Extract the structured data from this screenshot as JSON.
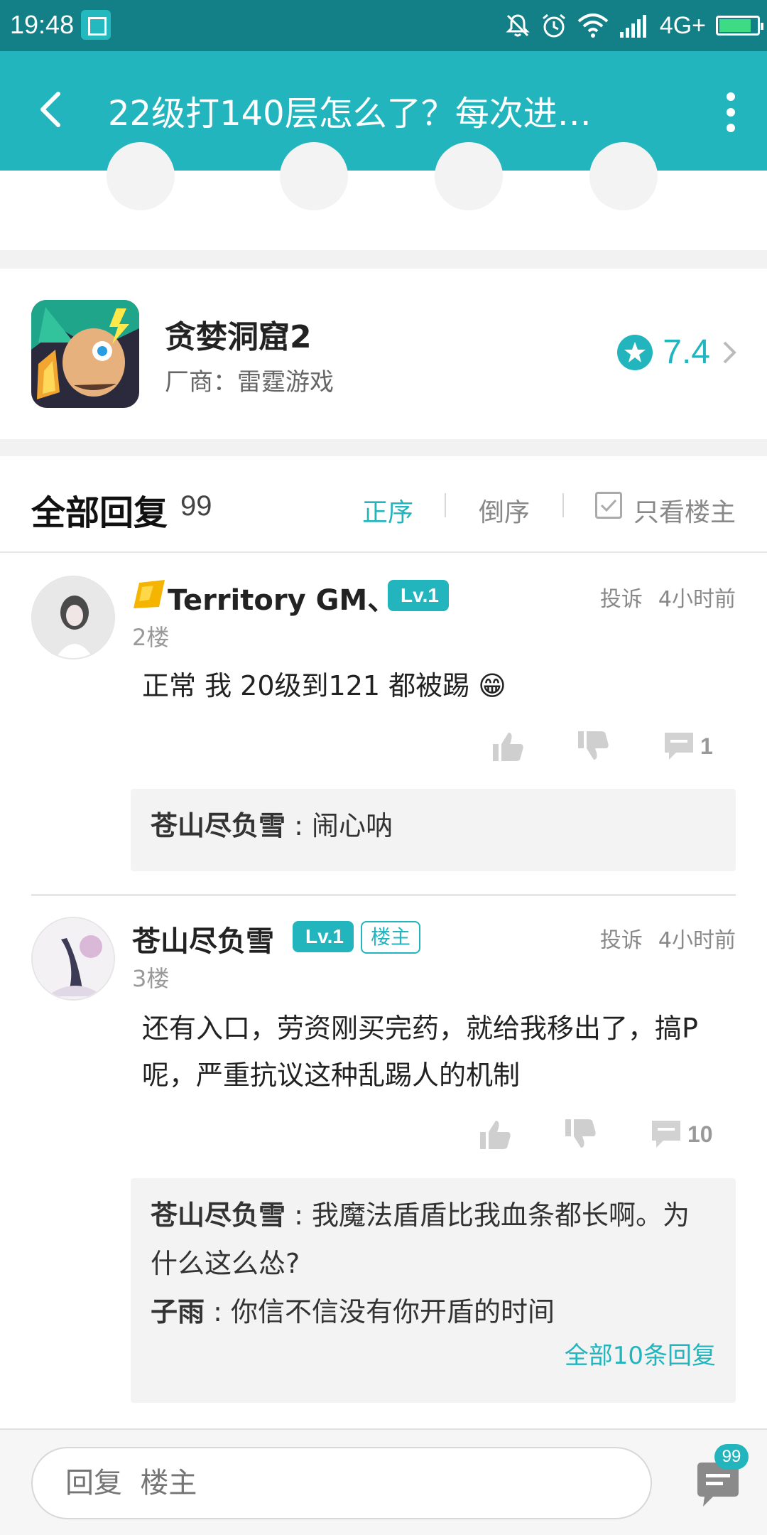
{
  "status_bar": {
    "time": "19:48",
    "network": "4G+",
    "battery_level": 0.85
  },
  "app_bar": {
    "title": "22级打140层怎么了？每次进…"
  },
  "game": {
    "name": "贪婪洞窟2",
    "maker": "厂商：雷霆游戏",
    "rating": "7.4"
  },
  "replies_header": {
    "title": "全部回复",
    "count": "99",
    "sort_asc": "正序",
    "sort_desc": "倒序",
    "only_host": "只看楼主"
  },
  "posts": [
    {
      "username": "Territory GM、.",
      "level": "Lv.1",
      "report": "投诉",
      "time": "4小时前",
      "floor": "2楼",
      "content": "正常 我 20级到121 都被踢 😁",
      "comment_count": "1",
      "sub_replies": [
        {
          "user": "苍山尽负雪",
          "text": " : 闹心呐"
        }
      ]
    },
    {
      "username": "苍山尽负雪",
      "level": "Lv.1",
      "host_badge": "楼主",
      "report": "投诉",
      "time": "4小时前",
      "floor": "3楼",
      "content": "还有入口，劳资刚买完药，就给我移出了，搞P呢，严重抗议这种乱踢人的机制",
      "comment_count": "10",
      "sub_replies": [
        {
          "user": "苍山尽负雪",
          "text": " : 我魔法盾盾比我血条都长啊。为什么这么怂?"
        },
        {
          "user": "子雨",
          "text": " : 你信不信没有你开盾的时间"
        }
      ],
      "all_replies_link": "全部10条回复"
    }
  ],
  "bottom": {
    "reply_placeholder": "回复  楼主",
    "message_badge": "99"
  },
  "colors": {
    "accent": "#22b5bd",
    "status_bar": "#137f86"
  }
}
